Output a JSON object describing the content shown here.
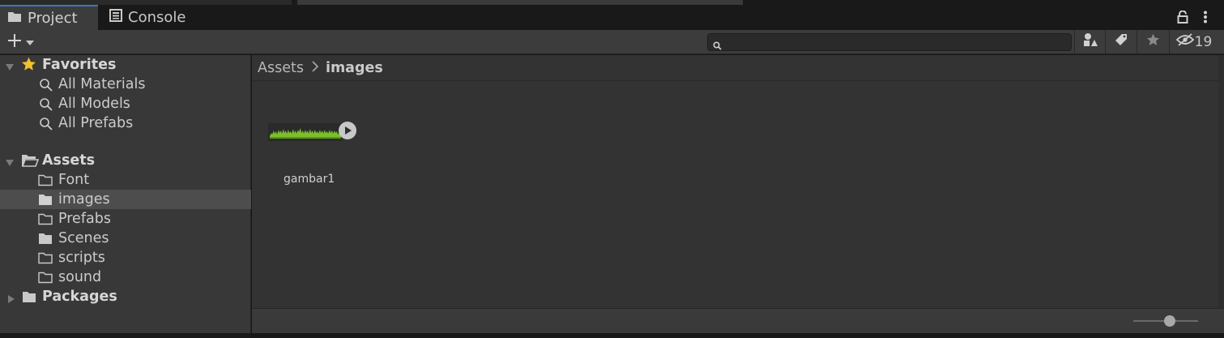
{
  "tabs": [
    {
      "label": "Project",
      "icon": "folder-icon",
      "active": true
    },
    {
      "label": "Console",
      "icon": "console-icon",
      "active": false
    }
  ],
  "toolbar": {
    "search_value": "",
    "hidden_packages_count": "19"
  },
  "sidebar": {
    "favorites": {
      "label": "Favorites",
      "items": [
        "All Materials",
        "All Models",
        "All Prefabs"
      ]
    },
    "assets": {
      "label": "Assets",
      "children": [
        "Font",
        "images",
        "Prefabs",
        "Scenes",
        "scripts",
        "sound"
      ],
      "selected": "images"
    },
    "packages": {
      "label": "Packages"
    }
  },
  "breadcrumb": {
    "root": "Assets",
    "current": "images"
  },
  "assets_grid": [
    {
      "name": "gambar1",
      "type": "sprite"
    }
  ],
  "colors": {
    "accent": "#3a79bb",
    "panel": "#383838",
    "selected_row": "#4d4d4d",
    "star": "#f4c12c",
    "grass": "#7bc02a"
  }
}
